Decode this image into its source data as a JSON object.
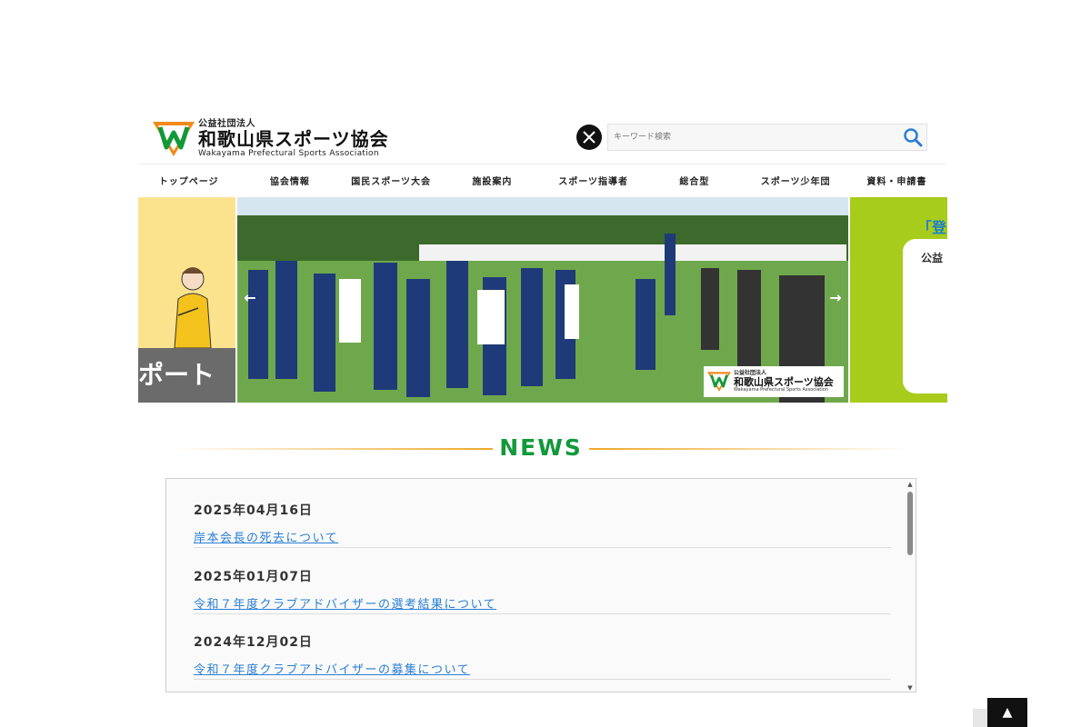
{
  "header": {
    "logo_sub": "公益社団法人",
    "logo_main": "和歌山県スポーツ協会",
    "logo_en": "Wakayama Prefectural Sports Association",
    "x_icon": "x-twitter-icon",
    "search_placeholder": "キーワード検索",
    "search_icon": "search-icon"
  },
  "nav": {
    "items": [
      {
        "label": "トップページ"
      },
      {
        "label": "協会情報"
      },
      {
        "label": "国民スポーツ大会"
      },
      {
        "label": "施設案内"
      },
      {
        "label": "スポーツ指導者"
      },
      {
        "label": "総合型"
      },
      {
        "label": "スポーツ少年団"
      },
      {
        "label": "資料・申請書"
      }
    ]
  },
  "slider": {
    "left_text": "ポート",
    "right_heading": "「登",
    "right_text": "公益",
    "prev": "←",
    "next": "→",
    "badge_sub": "公益社団法人",
    "badge_main": "和歌山県スポーツ協会",
    "badge_en": "Wakayama Prefectural Sports Association"
  },
  "news": {
    "title": "NEWS",
    "items": [
      {
        "date": "2025年04月16日",
        "title": "岸本会長の死去について"
      },
      {
        "date": "2025年01月07日",
        "title": "令和７年度クラブアドバイザーの選考結果について"
      },
      {
        "date": "2024年12月02日",
        "title": "令和７年度クラブアドバイザーの募集について"
      }
    ],
    "scroll_up": "▲",
    "scroll_down": "▼"
  },
  "pagetop": {
    "label": "▲"
  },
  "colors": {
    "accent_green": "#12993a",
    "link_blue": "#2a7fd4",
    "line_orange": "#f0a828",
    "slide_lime": "#a8cc1c",
    "slide_yellow": "#fbe38e"
  }
}
